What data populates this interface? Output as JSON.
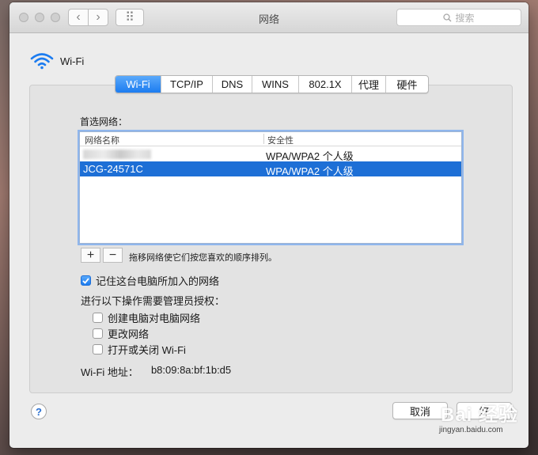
{
  "window": {
    "title": "网络"
  },
  "toolbar": {
    "back_glyph": "‹",
    "forward_glyph": "›",
    "grid_glyph": "⠿",
    "search_placeholder": "搜索"
  },
  "header": {
    "label": "Wi-Fi",
    "icon": "wifi-icon"
  },
  "tabs": [
    {
      "label": "Wi-Fi",
      "active": true
    },
    {
      "label": "TCP/IP",
      "active": false
    },
    {
      "label": "DNS",
      "active": false
    },
    {
      "label": "WINS",
      "active": false
    },
    {
      "label": "802.1X",
      "active": false
    },
    {
      "label": "代理",
      "active": false
    },
    {
      "label": "硬件",
      "active": false
    }
  ],
  "preferred": {
    "title": "首选网络：",
    "columns": [
      "网络名称",
      "安全性"
    ],
    "rows": [
      {
        "name": "",
        "security": "WPA/WPA2 个人级",
        "selected": false,
        "obscured": true
      },
      {
        "name": "JCG-24571C",
        "security": "WPA/WPA2 个人级",
        "selected": true,
        "obscured": false
      }
    ],
    "add_label": "+",
    "remove_label": "−",
    "hint": "拖移网络使它们按您喜欢的顺序排列。"
  },
  "remember": {
    "label": "记住这台电脑所加入的网络",
    "checked": true
  },
  "admin": {
    "title": "进行以下操作需要管理员授权：",
    "options": [
      {
        "label": "创建电脑对电脑网络",
        "checked": false
      },
      {
        "label": "更改网络",
        "checked": false
      },
      {
        "label": "打开或关闭 Wi-Fi",
        "checked": false
      }
    ]
  },
  "address": {
    "label": "Wi-Fi 地址：",
    "value": "b8:09:8a:bf:1b:d5"
  },
  "footer": {
    "help": "?",
    "cancel": "取消",
    "ok": "好"
  },
  "watermark": {
    "brand": "Bai 经验",
    "url": "jingyan.baidu.com"
  },
  "colors": {
    "accent": "#1c7cf0",
    "selection": "#1d6fd6"
  }
}
